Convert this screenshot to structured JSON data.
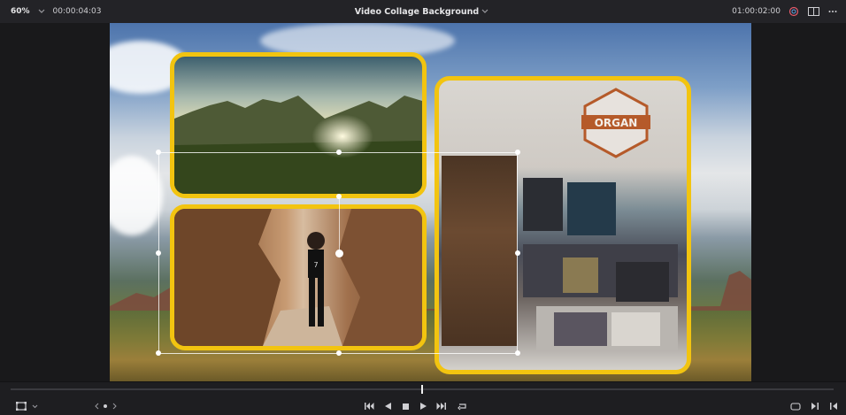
{
  "topbar": {
    "zoom": "60%",
    "timecode_left": "00:00:04:03",
    "title": "Video Collage Background",
    "timecode_right": "01:00:02:00"
  },
  "viewer": {
    "sign_text": "ORGAN",
    "shirt_text": "7"
  },
  "bottom": {
    "playhead_fraction": 0.5
  },
  "colors": {
    "tile_border": "#f2c410",
    "background": "#1b1b1e"
  },
  "icons": {
    "dropdown": "chevron-down-icon",
    "nav_left": "chevron-left-icon",
    "nav_right": "chevron-right-icon"
  }
}
